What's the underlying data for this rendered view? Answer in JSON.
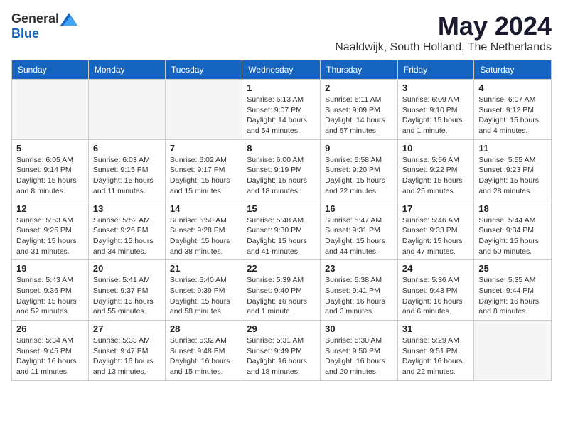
{
  "header": {
    "logo_general": "General",
    "logo_blue": "Blue",
    "month": "May 2024",
    "location": "Naaldwijk, South Holland, The Netherlands"
  },
  "weekdays": [
    "Sunday",
    "Monday",
    "Tuesday",
    "Wednesday",
    "Thursday",
    "Friday",
    "Saturday"
  ],
  "weeks": [
    [
      {
        "day": "",
        "info": ""
      },
      {
        "day": "",
        "info": ""
      },
      {
        "day": "",
        "info": ""
      },
      {
        "day": "1",
        "info": "Sunrise: 6:13 AM\nSunset: 9:07 PM\nDaylight: 14 hours\nand 54 minutes."
      },
      {
        "day": "2",
        "info": "Sunrise: 6:11 AM\nSunset: 9:09 PM\nDaylight: 14 hours\nand 57 minutes."
      },
      {
        "day": "3",
        "info": "Sunrise: 6:09 AM\nSunset: 9:10 PM\nDaylight: 15 hours\nand 1 minute."
      },
      {
        "day": "4",
        "info": "Sunrise: 6:07 AM\nSunset: 9:12 PM\nDaylight: 15 hours\nand 4 minutes."
      }
    ],
    [
      {
        "day": "5",
        "info": "Sunrise: 6:05 AM\nSunset: 9:14 PM\nDaylight: 15 hours\nand 8 minutes."
      },
      {
        "day": "6",
        "info": "Sunrise: 6:03 AM\nSunset: 9:15 PM\nDaylight: 15 hours\nand 11 minutes."
      },
      {
        "day": "7",
        "info": "Sunrise: 6:02 AM\nSunset: 9:17 PM\nDaylight: 15 hours\nand 15 minutes."
      },
      {
        "day": "8",
        "info": "Sunrise: 6:00 AM\nSunset: 9:19 PM\nDaylight: 15 hours\nand 18 minutes."
      },
      {
        "day": "9",
        "info": "Sunrise: 5:58 AM\nSunset: 9:20 PM\nDaylight: 15 hours\nand 22 minutes."
      },
      {
        "day": "10",
        "info": "Sunrise: 5:56 AM\nSunset: 9:22 PM\nDaylight: 15 hours\nand 25 minutes."
      },
      {
        "day": "11",
        "info": "Sunrise: 5:55 AM\nSunset: 9:23 PM\nDaylight: 15 hours\nand 28 minutes."
      }
    ],
    [
      {
        "day": "12",
        "info": "Sunrise: 5:53 AM\nSunset: 9:25 PM\nDaylight: 15 hours\nand 31 minutes."
      },
      {
        "day": "13",
        "info": "Sunrise: 5:52 AM\nSunset: 9:26 PM\nDaylight: 15 hours\nand 34 minutes."
      },
      {
        "day": "14",
        "info": "Sunrise: 5:50 AM\nSunset: 9:28 PM\nDaylight: 15 hours\nand 38 minutes."
      },
      {
        "day": "15",
        "info": "Sunrise: 5:48 AM\nSunset: 9:30 PM\nDaylight: 15 hours\nand 41 minutes."
      },
      {
        "day": "16",
        "info": "Sunrise: 5:47 AM\nSunset: 9:31 PM\nDaylight: 15 hours\nand 44 minutes."
      },
      {
        "day": "17",
        "info": "Sunrise: 5:46 AM\nSunset: 9:33 PM\nDaylight: 15 hours\nand 47 minutes."
      },
      {
        "day": "18",
        "info": "Sunrise: 5:44 AM\nSunset: 9:34 PM\nDaylight: 15 hours\nand 50 minutes."
      }
    ],
    [
      {
        "day": "19",
        "info": "Sunrise: 5:43 AM\nSunset: 9:36 PM\nDaylight: 15 hours\nand 52 minutes."
      },
      {
        "day": "20",
        "info": "Sunrise: 5:41 AM\nSunset: 9:37 PM\nDaylight: 15 hours\nand 55 minutes."
      },
      {
        "day": "21",
        "info": "Sunrise: 5:40 AM\nSunset: 9:39 PM\nDaylight: 15 hours\nand 58 minutes."
      },
      {
        "day": "22",
        "info": "Sunrise: 5:39 AM\nSunset: 9:40 PM\nDaylight: 16 hours\nand 1 minute."
      },
      {
        "day": "23",
        "info": "Sunrise: 5:38 AM\nSunset: 9:41 PM\nDaylight: 16 hours\nand 3 minutes."
      },
      {
        "day": "24",
        "info": "Sunrise: 5:36 AM\nSunset: 9:43 PM\nDaylight: 16 hours\nand 6 minutes."
      },
      {
        "day": "25",
        "info": "Sunrise: 5:35 AM\nSunset: 9:44 PM\nDaylight: 16 hours\nand 8 minutes."
      }
    ],
    [
      {
        "day": "26",
        "info": "Sunrise: 5:34 AM\nSunset: 9:45 PM\nDaylight: 16 hours\nand 11 minutes."
      },
      {
        "day": "27",
        "info": "Sunrise: 5:33 AM\nSunset: 9:47 PM\nDaylight: 16 hours\nand 13 minutes."
      },
      {
        "day": "28",
        "info": "Sunrise: 5:32 AM\nSunset: 9:48 PM\nDaylight: 16 hours\nand 15 minutes."
      },
      {
        "day": "29",
        "info": "Sunrise: 5:31 AM\nSunset: 9:49 PM\nDaylight: 16 hours\nand 18 minutes."
      },
      {
        "day": "30",
        "info": "Sunrise: 5:30 AM\nSunset: 9:50 PM\nDaylight: 16 hours\nand 20 minutes."
      },
      {
        "day": "31",
        "info": "Sunrise: 5:29 AM\nSunset: 9:51 PM\nDaylight: 16 hours\nand 22 minutes."
      },
      {
        "day": "",
        "info": ""
      }
    ]
  ]
}
